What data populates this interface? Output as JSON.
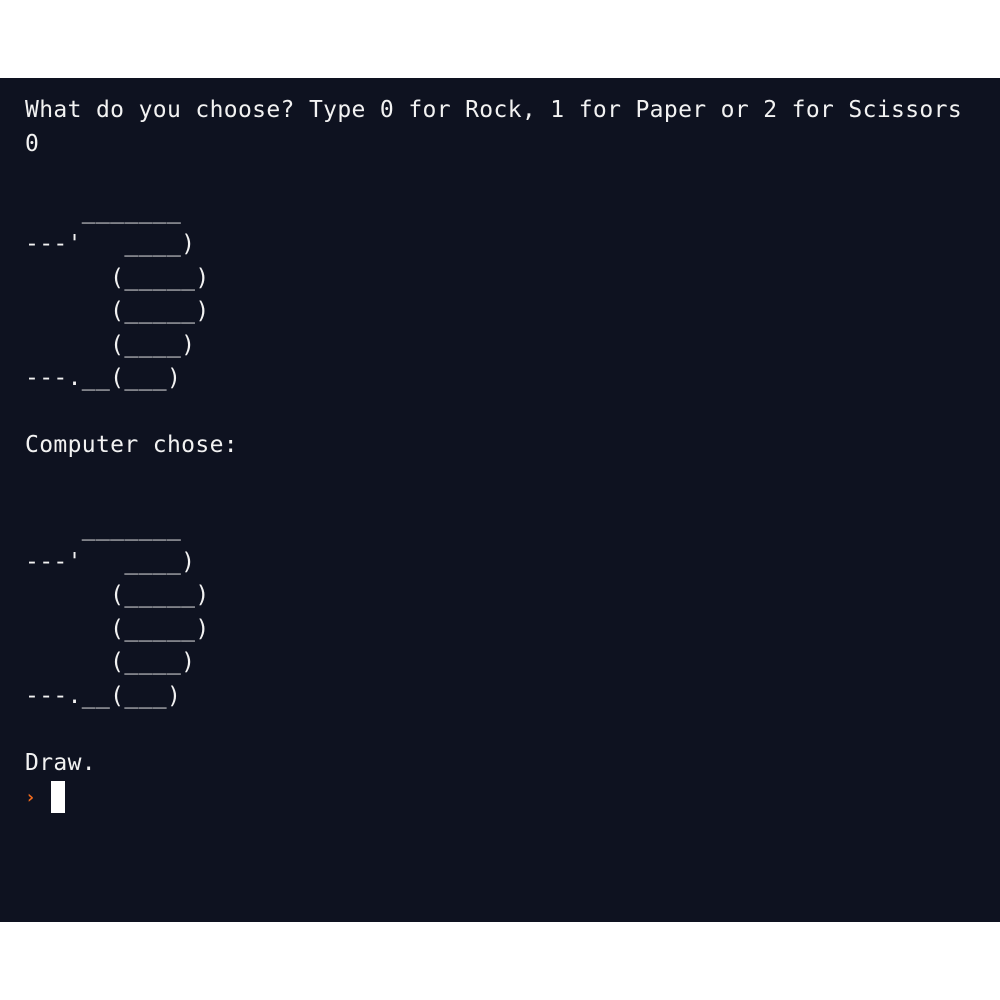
{
  "terminal": {
    "question": "What do you choose? Type 0 for Rock, 1 for Paper or 2 for Scissors",
    "user_input": "0",
    "player_art": [
      "    _______",
      "---'   ____)",
      "      (_____)",
      "      (_____)",
      "      (____)",
      "---.__(___)"
    ],
    "computer_label": "Computer chose:",
    "computer_art": [
      "    _______",
      "---'   ____)",
      "      (_____)",
      "      (_____)",
      "      (____)",
      "---.__(___)"
    ],
    "result": "Draw.",
    "prompt_symbol": "›"
  },
  "colors": {
    "background": "#0e1220",
    "text": "#f2f2f2",
    "prompt": "#f26b1d",
    "cursor": "#ffffff"
  }
}
